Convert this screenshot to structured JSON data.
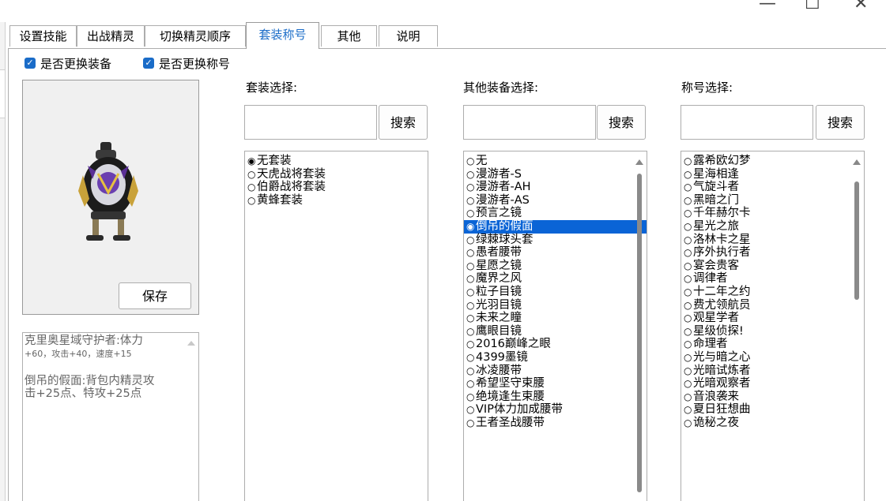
{
  "window": {
    "minimize": "—",
    "maximize": "☐",
    "close": "✕"
  },
  "tabs": [
    {
      "label": "设置技能"
    },
    {
      "label": "出战精灵"
    },
    {
      "label": "切换精灵顺序"
    },
    {
      "label": "套装称号",
      "active": true
    },
    {
      "label": "其他"
    },
    {
      "label": "说明"
    }
  ],
  "options": {
    "change_equipment": {
      "label": "是否更换装备",
      "checked": true
    },
    "change_title": {
      "label": "是否更换称号",
      "checked": true
    }
  },
  "preview": {
    "save_label": "保存"
  },
  "description": {
    "line1a": "克里奥星域守护者:体力",
    "line1b": "+60，攻击+40，速度+15",
    "line2a": "倒吊的假面:背包内精灵攻",
    "line2b": "击+25点、特攻+25点"
  },
  "suit": {
    "label": "套装选择:",
    "search_value": "",
    "search_label": "搜索",
    "items": [
      "无套装",
      "天虎战将套装",
      "伯爵战将套装",
      "黄蜂套装"
    ],
    "selected_index": 0
  },
  "equipment": {
    "label": "其他装备选择:",
    "search_value": "",
    "search_label": "搜索",
    "items": [
      "无",
      "漫游者-S",
      "漫游者-AH",
      "漫游者-AS",
      "预言之镜",
      "倒吊的假面",
      "绿棘球头套",
      "愚者腰带",
      "星愿之镜",
      "魔界之风",
      "粒子目镜",
      "光羽目镜",
      "未来之瞳",
      "鹰眼目镜",
      "2016巅峰之眼",
      "4399墨镜",
      "冰凌腰带",
      "希望坚守束腰",
      "绝境逢生束腰",
      "VIP体力加成腰带",
      "王者圣战腰带"
    ],
    "selected_index": 5
  },
  "title": {
    "label": "称号选择:",
    "search_value": "",
    "search_label": "搜索",
    "items": [
      "露希欧幻梦",
      "星海相逢",
      "气旋斗者",
      "黑暗之门",
      "千年赫尔卡",
      "星光之旅",
      "洛林卡之星",
      "序外执行者",
      "宴会贵客",
      "调律者",
      "十二年之约",
      "费尤领航员",
      "观星学者",
      "星级侦探!",
      "命理者",
      "光与暗之心",
      "光暗试炼者",
      "光暗观察者",
      "音浪袭来",
      "夏日狂想曲",
      "诡秘之夜"
    ],
    "selected_index": -1
  },
  "colors": {
    "accent": "#1a6cc8",
    "selection": "#0a64d6"
  }
}
